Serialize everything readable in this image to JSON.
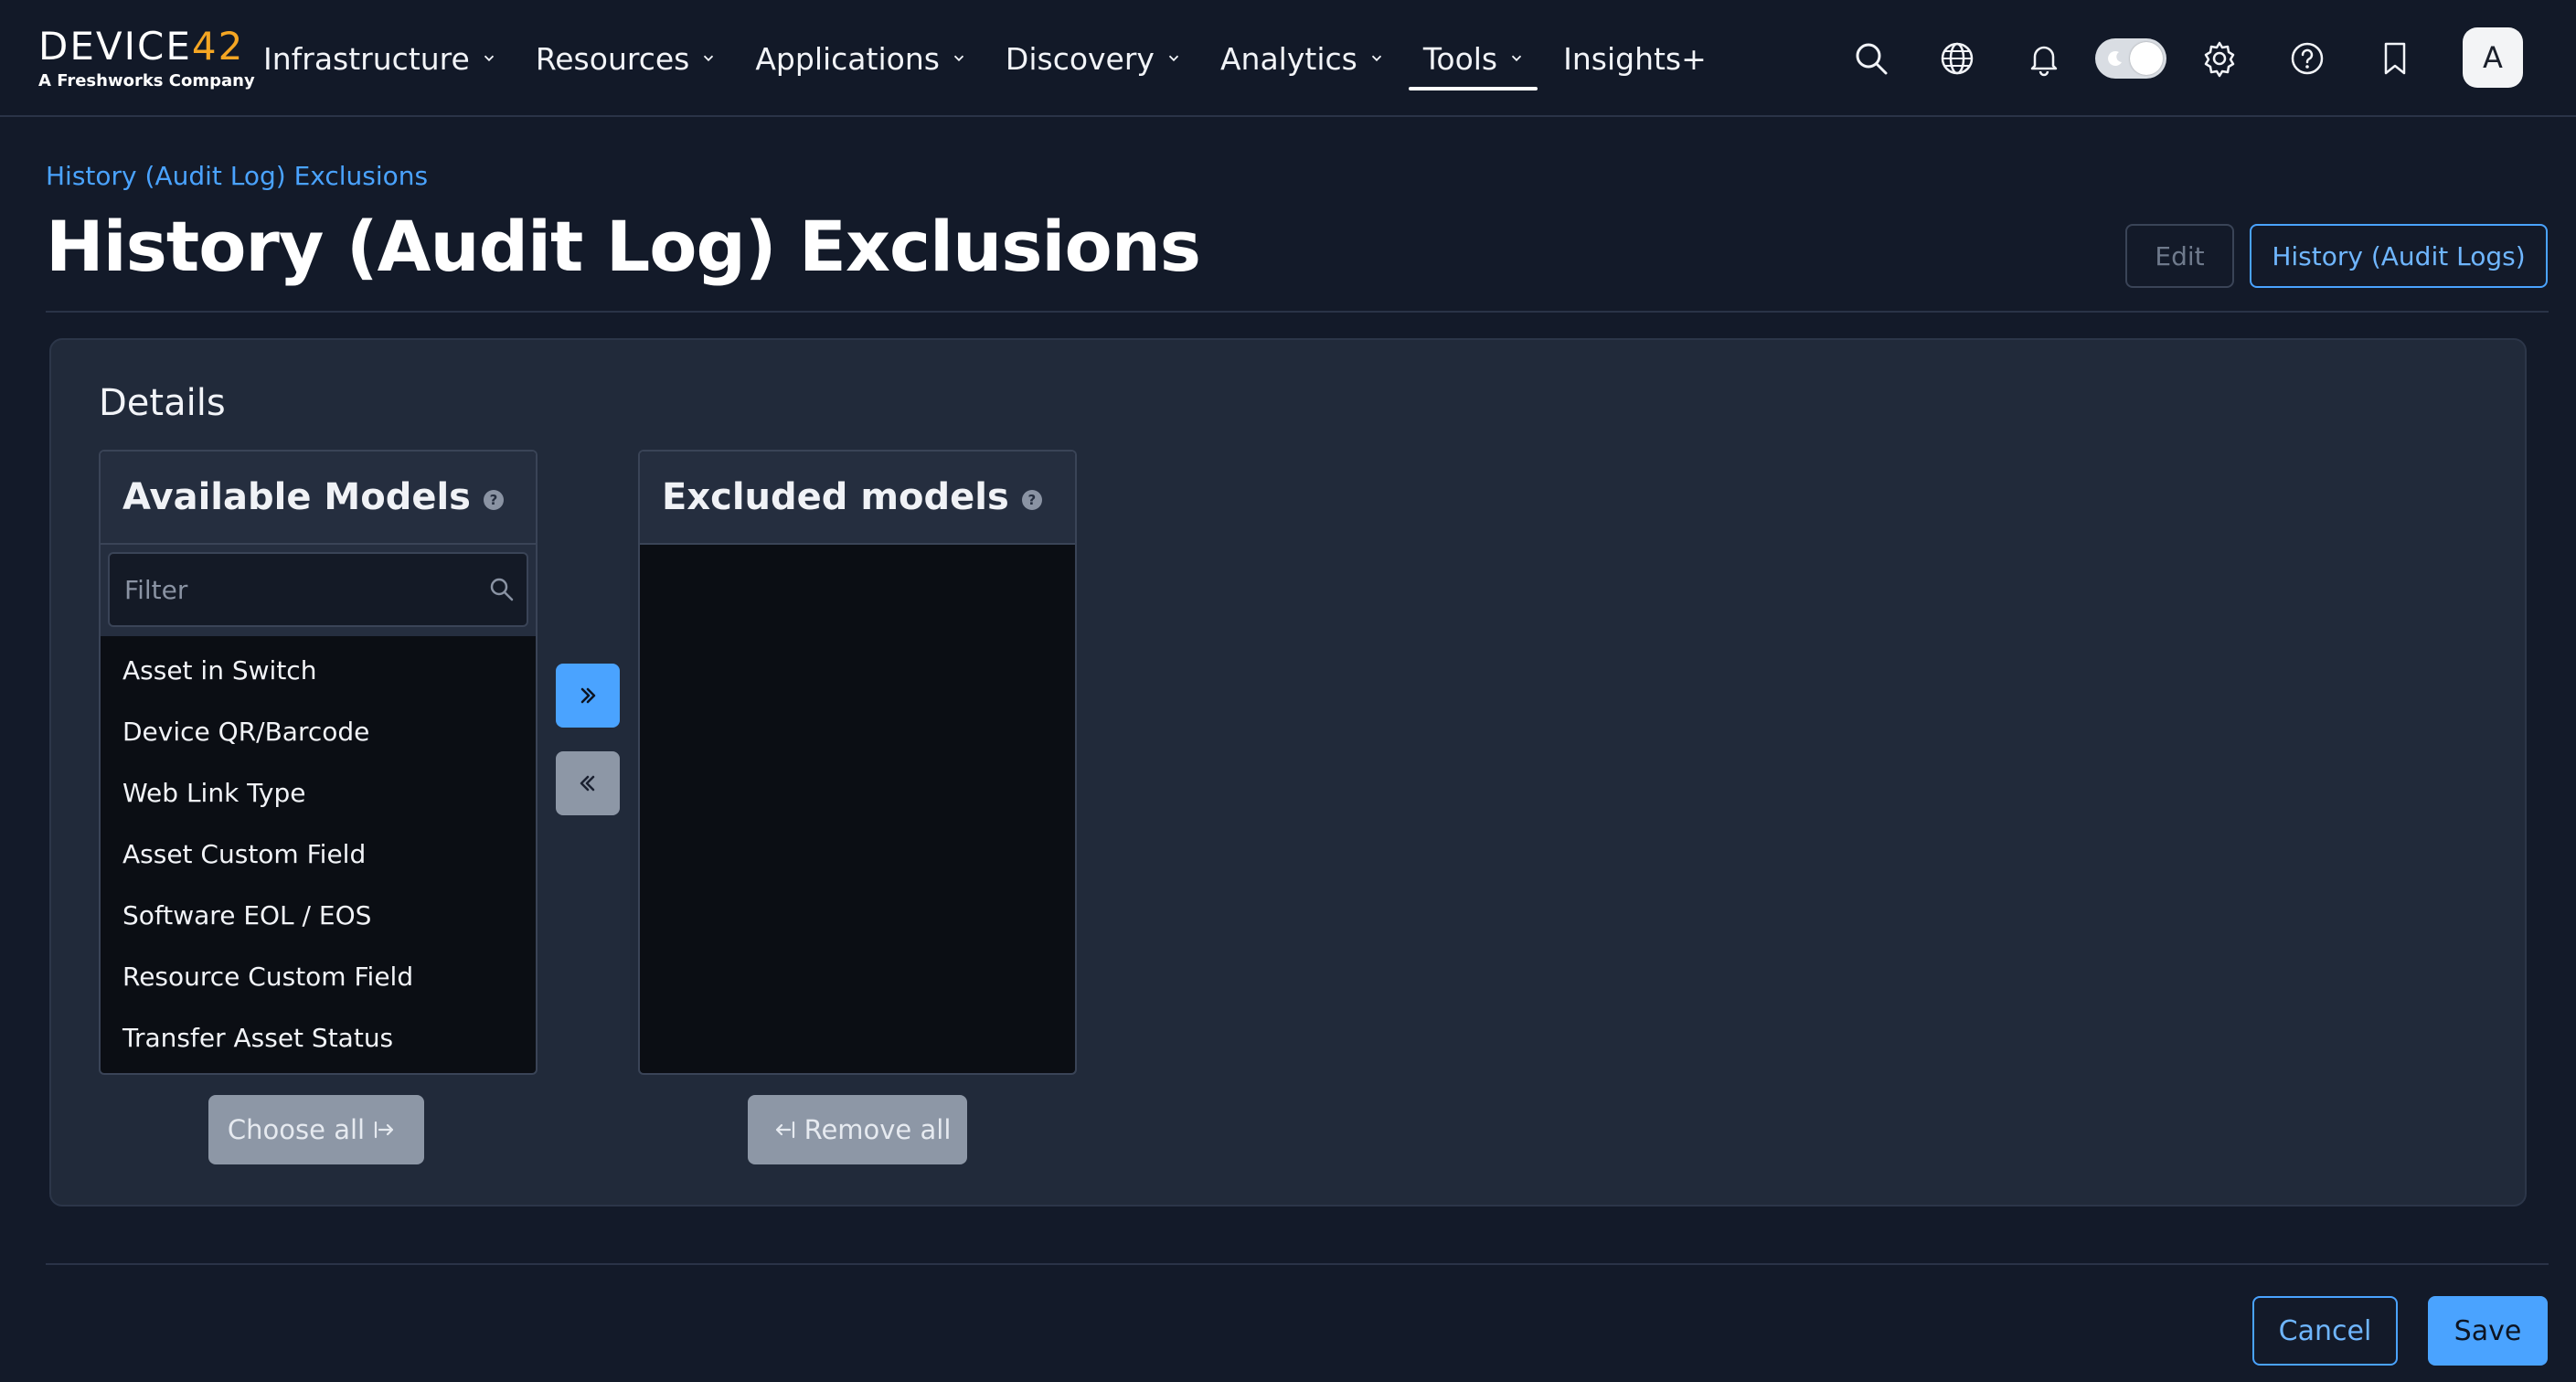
{
  "brand": {
    "logo_text": "DEVICE",
    "logo_accent": "42",
    "tagline": "A Freshworks Company"
  },
  "nav": {
    "items": [
      {
        "label": "Infrastructure"
      },
      {
        "label": "Resources"
      },
      {
        "label": "Applications"
      },
      {
        "label": "Discovery"
      },
      {
        "label": "Analytics"
      },
      {
        "label": "Tools"
      },
      {
        "label": "Insights+"
      }
    ],
    "active": "Tools"
  },
  "toolbar": {
    "icons": [
      "search-icon",
      "globe-icon",
      "bell-icon",
      "theme-toggle",
      "gear-icon",
      "help-icon",
      "bookmark-icon"
    ],
    "avatar_initial": "A"
  },
  "header": {
    "breadcrumb": "History (Audit Log) Exclusions",
    "title": "History (Audit Log) Exclusions",
    "edit_label": "Edit",
    "history_label": "History (Audit Logs)"
  },
  "details": {
    "title": "Details",
    "available": {
      "title": "Available Models",
      "filter_placeholder": "Filter",
      "items": [
        "Asset in Switch",
        "Device QR/Barcode",
        "Web Link Type",
        "Asset Custom Field",
        "Software EOL / EOS",
        "Resource Custom Field",
        "Transfer Asset Status"
      ]
    },
    "excluded": {
      "title": "Excluded models",
      "items": []
    },
    "choose_all_label": "Choose all",
    "remove_all_label": "Remove all"
  },
  "footer": {
    "cancel_label": "Cancel",
    "save_label": "Save"
  },
  "colors": {
    "accent": "#4aa3ff",
    "brand_accent": "#f5a623",
    "background": "#131a29"
  }
}
